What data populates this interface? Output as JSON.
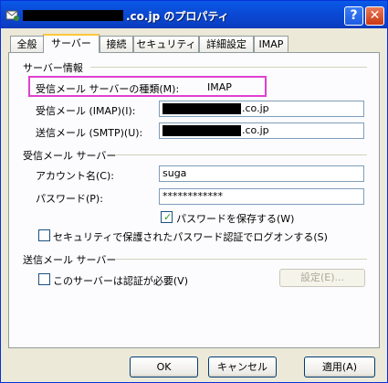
{
  "window": {
    "title_suffix": ".co.jp のプロパティ",
    "help_glyph": "?",
    "close_glyph": "✕"
  },
  "tabs": [
    "全般",
    "サーバー",
    "接続",
    "セキュリティ",
    "詳細設定",
    "IMAP"
  ],
  "server_info": {
    "section": "サーバー情報",
    "type_label": "受信メール サーバーの種類(M):",
    "type_value": "IMAP",
    "imap_label": "受信メール (IMAP)(I):",
    "imap_value_suffix": ".co.jp",
    "smtp_label": "送信メール (SMTP)(U):",
    "smtp_value_suffix": ".co.jp"
  },
  "incoming": {
    "section": "受信メール サーバー",
    "account_label": "アカウント名(C):",
    "account_value": "suga",
    "password_label": "パスワード(P):",
    "password_value": "************",
    "save_password_label": "パスワードを保存する(W)",
    "save_password_checked": true,
    "secure_auth_label": "セキュリティで保護されたパスワード認証でログオンする(S)",
    "secure_auth_checked": false
  },
  "outgoing": {
    "section": "送信メール サーバー",
    "auth_label": "このサーバーは認証が必要(V)",
    "auth_checked": false,
    "settings_label": "設定(E)..."
  },
  "buttons": {
    "ok": "OK",
    "cancel": "キャンセル",
    "apply": "適用(A)"
  }
}
